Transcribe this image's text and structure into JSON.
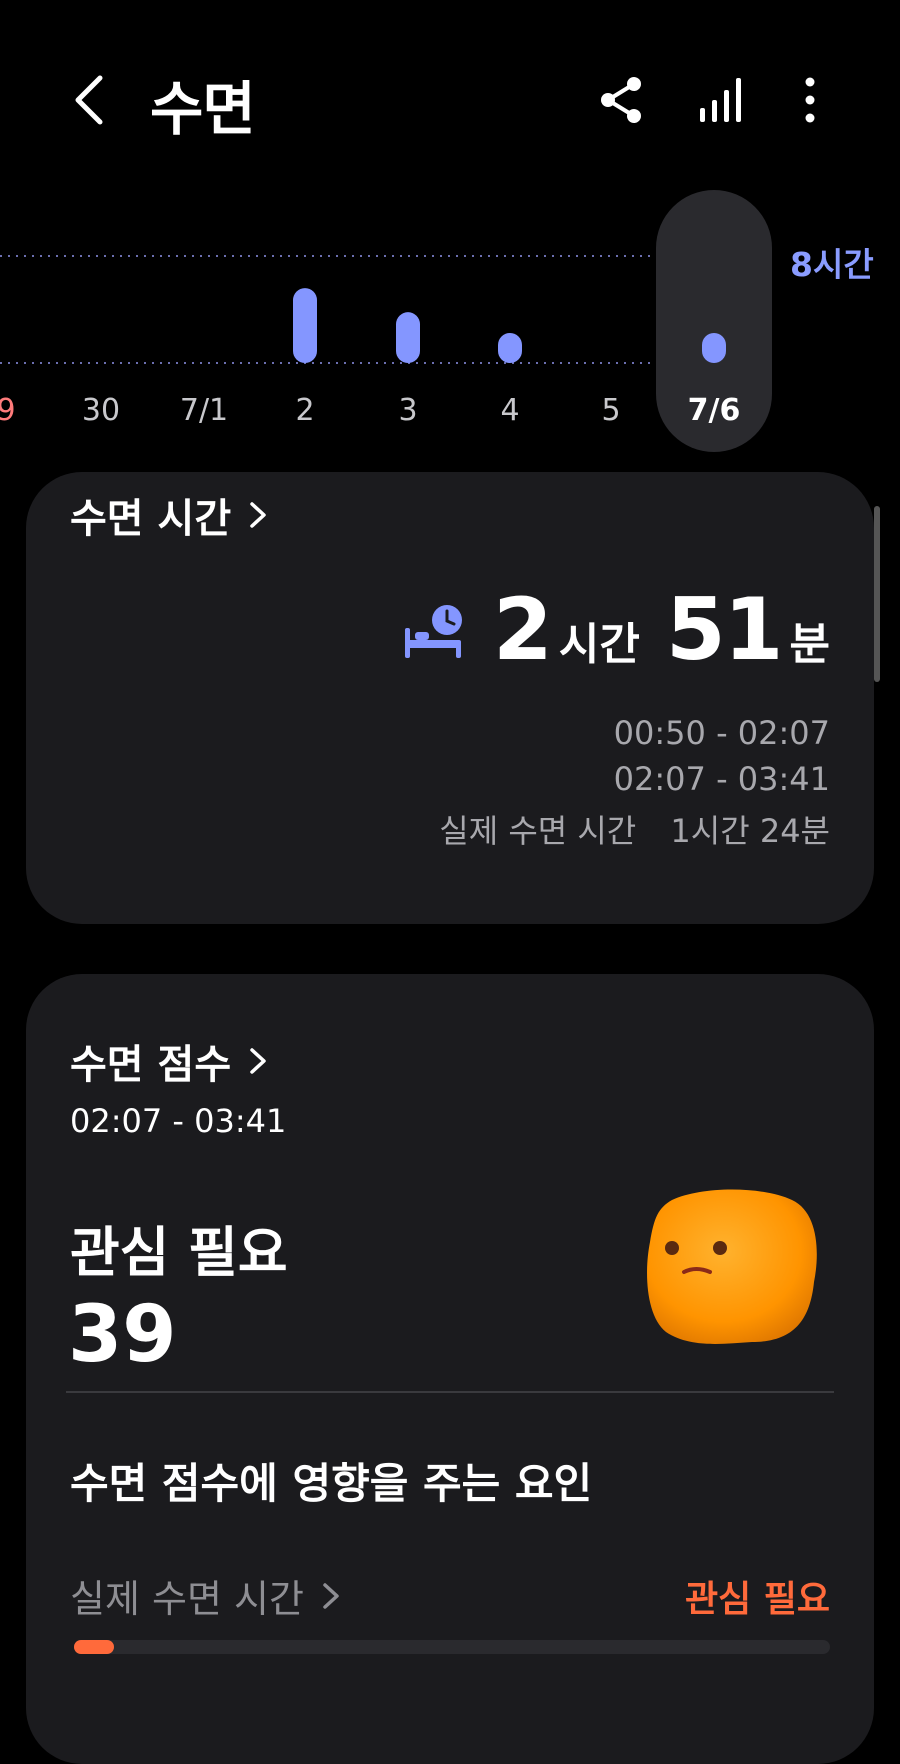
{
  "header": {
    "title": "수면",
    "back_icon": "chevron-left-icon",
    "actions": [
      "share-icon",
      "chart-icon",
      "more-vertical-icon"
    ]
  },
  "chart_data": {
    "type": "bar",
    "categories": [
      "9",
      "30",
      "7/1",
      "2",
      "3",
      "4",
      "5",
      "7/6"
    ],
    "values": [
      0,
      0,
      0,
      5.6,
      3.8,
      2.0,
      0,
      2.0
    ],
    "ylim": [
      0,
      8
    ],
    "reference_line": {
      "value": 8,
      "label": "8시간"
    },
    "selected": "7/6",
    "colors": {
      "bar": "#8496ff",
      "first_label": "#ff7b7b",
      "reference": "#8a9cff"
    }
  },
  "sleep_time": {
    "title": "수면 시간",
    "hours": "2",
    "hours_unit": "시간",
    "minutes": "51",
    "minutes_unit": "분",
    "ranges": [
      "00:50 - 02:07",
      "02:07 - 03:41"
    ],
    "actual_label": "실제 수면 시간",
    "actual_value": "1시간 24분",
    "icon": "bed-clock-icon"
  },
  "sleep_score": {
    "title": "수면 점수",
    "range": "02:07 - 03:41",
    "status": "관심 필요",
    "score": "39",
    "mascot": "fuzzy-orange-character",
    "factors_title": "수면 점수에 영향을 주는 요인",
    "factors": [
      {
        "label": "실제 수면 시간",
        "status": "관심 필요",
        "progress": 0.05,
        "status_color": "#ff6a3b"
      }
    ]
  }
}
